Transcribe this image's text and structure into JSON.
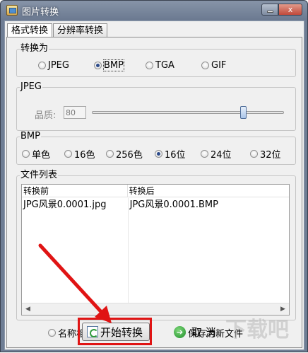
{
  "window": {
    "title": "图片转换",
    "minimize_label": "_",
    "close_label": "x"
  },
  "tabs": [
    {
      "label": "格式转换",
      "active": true
    },
    {
      "label": "分辨率转换",
      "active": false
    }
  ],
  "convert_to": {
    "label": "转换为",
    "options": [
      {
        "label": "JPEG",
        "checked": false
      },
      {
        "label": "BMP",
        "checked": true
      },
      {
        "label": "TGA",
        "checked": false
      },
      {
        "label": "GIF",
        "checked": false
      }
    ]
  },
  "jpeg": {
    "label": "JPEG",
    "quality_label": "品质:",
    "quality_value": "80",
    "quality_slider": 0.8
  },
  "bmp": {
    "label": "BMP",
    "options": [
      {
        "label": "单色",
        "checked": false
      },
      {
        "label": "16色",
        "checked": false
      },
      {
        "label": "256色",
        "checked": false
      },
      {
        "label": "16位",
        "checked": true
      },
      {
        "label": "24位",
        "checked": false
      },
      {
        "label": "32位",
        "checked": false
      }
    ]
  },
  "file_list": {
    "label": "文件列表",
    "columns": [
      "转换前",
      "转换后"
    ],
    "rows": [
      {
        "before": "JPG风景0.0001.jpg",
        "after": "JPG风景0.0001.BMP"
      }
    ]
  },
  "save_mode": {
    "options": [
      {
        "label": "名称相同直接覆盖",
        "checked": false
      },
      {
        "label": "保存为新文件",
        "checked": true
      }
    ]
  },
  "buttons": {
    "start": "开始转换",
    "cancel": "取 消"
  },
  "watermark": "下载吧",
  "colors": {
    "highlight": "#e01414",
    "titlebar": "#6c7a91",
    "accent_green": "#1e8f2a"
  }
}
